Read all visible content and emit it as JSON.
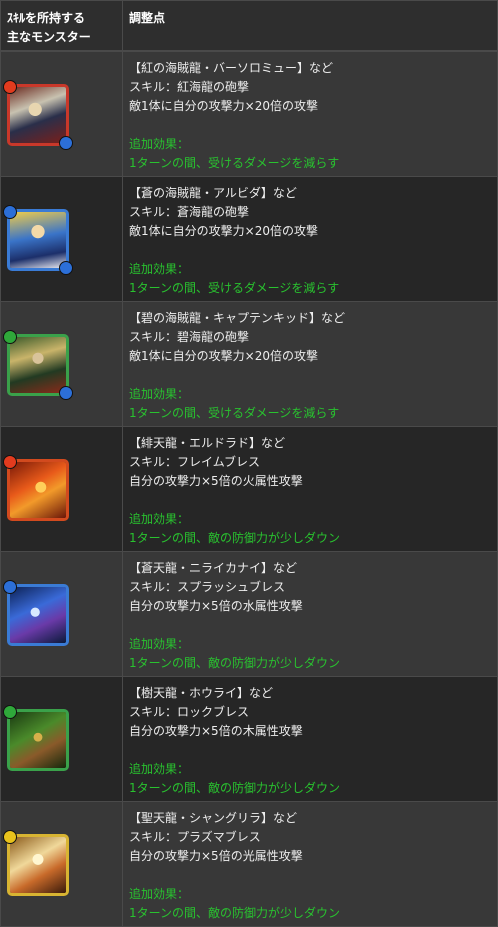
{
  "header": {
    "col1_line1": "ｽｷﾙを所持する",
    "col1_line2": "主なモンスター",
    "col2": "調整点"
  },
  "rows": [
    {
      "name_line": "【紅の海賊龍・バーソロミュー】など",
      "skill_line": "スキル：紅海龍の砲撃",
      "effect_line": "敵1体に自分の攻撃力×20倍の攻撃",
      "added_label": "追加効果：",
      "added_text": "1ターンの間、受けるダメージを減らす",
      "main_attr_color": "#e23b1e",
      "sub_attr_color": "#2c6fd8",
      "frame_color": "#c9382a",
      "icon_name": "pirate-dragon-bartholomew-icon"
    },
    {
      "name_line": "【蒼の海賊龍・アルビダ】など",
      "skill_line": "スキル：蒼海龍の砲撃",
      "effect_line": "敵1体に自分の攻撃力×20倍の攻撃",
      "added_label": "追加効果：",
      "added_text": "1ターンの間、受けるダメージを減らす",
      "main_attr_color": "#2c6fd8",
      "sub_attr_color": "#2c6fd8",
      "frame_color": "#3a7bd5",
      "icon_name": "pirate-dragon-alvida-icon"
    },
    {
      "name_line": "【碧の海賊龍・キャプテンキッド】など",
      "skill_line": "スキル：碧海龍の砲撃",
      "effect_line": "敵1体に自分の攻撃力×20倍の攻撃",
      "added_label": "追加効果：",
      "added_text": "1ターンの間、受けるダメージを減らす",
      "main_attr_color": "#2fa83a",
      "sub_attr_color": "#2c6fd8",
      "frame_color": "#3aa14a",
      "icon_name": "pirate-dragon-captain-kidd-icon"
    },
    {
      "name_line": "【緋天龍・エルドラド】など",
      "skill_line": "スキル：フレイムブレス",
      "effect_line": "自分の攻撃力×5倍の火属性攻撃",
      "added_label": "追加効果：",
      "added_text": "1ターンの間、敵の防御力が少しダウン",
      "main_attr_color": "#e23b1e",
      "sub_attr_color": "",
      "frame_color": "#d24a1e",
      "icon_name": "sky-dragon-eldorado-icon"
    },
    {
      "name_line": "【蒼天龍・ニライカナイ】など",
      "skill_line": "スキル：スプラッシュブレス",
      "effect_line": "自分の攻撃力×5倍の水属性攻撃",
      "added_label": "追加効果：",
      "added_text": "1ターンの間、敵の防御力が少しダウン",
      "main_attr_color": "#2c6fd8",
      "sub_attr_color": "",
      "frame_color": "#3a7bd5",
      "icon_name": "sky-dragon-niraikanai-icon"
    },
    {
      "name_line": "【樹天龍・ホウライ】など",
      "skill_line": "スキル：ロックブレス",
      "effect_line": "自分の攻撃力×5倍の木属性攻撃",
      "added_label": "追加効果：",
      "added_text": "1ターンの間、敵の防御力が少しダウン",
      "main_attr_color": "#2fa83a",
      "sub_attr_color": "",
      "frame_color": "#3aa14a",
      "icon_name": "sky-dragon-horai-icon"
    },
    {
      "name_line": "【聖天龍・シャングリラ】など",
      "skill_line": "スキル：プラズマブレス",
      "effect_line": "自分の攻撃力×5倍の光属性攻撃",
      "added_label": "追加効果：",
      "added_text": "1ターンの間、敵の防御力が少しダウン",
      "main_attr_color": "#e8c21c",
      "sub_attr_color": "",
      "frame_color": "#d8b432",
      "icon_name": "sky-dragon-shangrila-icon"
    }
  ]
}
